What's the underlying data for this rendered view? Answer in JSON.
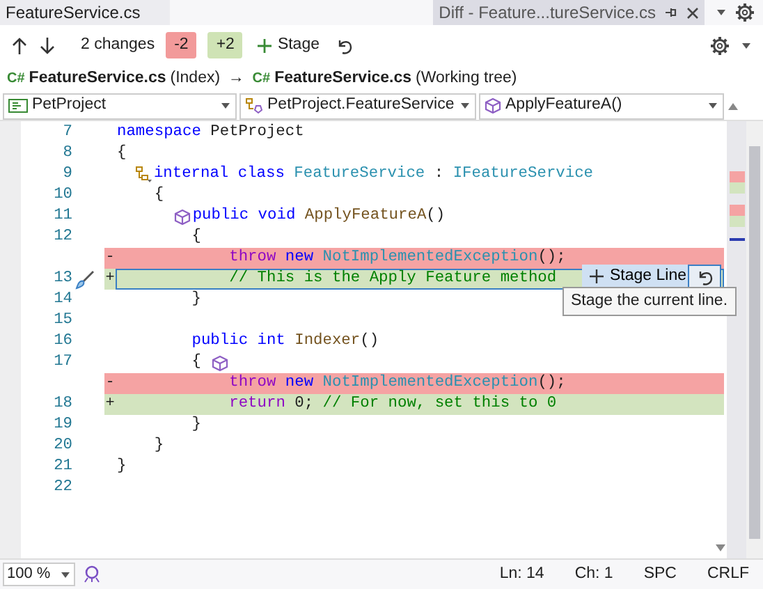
{
  "tabs": [
    {
      "label": "FeatureService.cs",
      "selected": false
    },
    {
      "label": "Diff - Feature...tureService.cs",
      "selected": true
    }
  ],
  "toolbar": {
    "changes": "2 changes",
    "removed": "-2",
    "added": "+2",
    "stage": "Stage"
  },
  "path": {
    "left_lang": "C#",
    "left_file": "FeatureService.cs",
    "left_label": "(Index)",
    "arrow": "→",
    "right_lang": "C#",
    "right_file": "FeatureService.cs",
    "right_label": "(Working tree)"
  },
  "dropdowns": [
    {
      "kind": "project",
      "label": "PetProject"
    },
    {
      "kind": "class",
      "label": "PetProject.FeatureService"
    },
    {
      "kind": "method",
      "label": "ApplyFeatureA()"
    }
  ],
  "lines": [
    {
      "number": "7",
      "kind": "context",
      "selected": false,
      "tokens": [
        {
          "kind": "keyword",
          "text": "namespace"
        },
        {
          "kind": "plain",
          "text": " PetProject"
        }
      ]
    },
    {
      "number": "8",
      "kind": "context",
      "selected": false,
      "tokens": [
        {
          "kind": "plain",
          "text": "{"
        }
      ]
    },
    {
      "number": "9",
      "kind": "context",
      "selected": false,
      "tokens": [
        {
          "kind": "indent"
        },
        {
          "kind": "class-icon"
        },
        {
          "kind": "keyword",
          "text": "internal class"
        },
        {
          "kind": "type",
          "text": " FeatureService"
        },
        {
          "kind": "plain",
          "text": " : "
        },
        {
          "kind": "type",
          "text": "IFeatureService"
        }
      ]
    },
    {
      "number": "10",
      "kind": "context",
      "selected": false,
      "tokens": [
        {
          "kind": "indent"
        },
        {
          "kind": "indent"
        },
        {
          "kind": "plain",
          "text": "{"
        }
      ]
    },
    {
      "number": "11",
      "kind": "context",
      "selected": false,
      "tokens": [
        {
          "kind": "indent"
        },
        {
          "kind": "indent"
        },
        {
          "kind": "indent"
        },
        {
          "kind": "method-icon"
        },
        {
          "kind": "keyword",
          "text": "public void"
        },
        {
          "kind": "method",
          "text": " ApplyFeatureA"
        },
        {
          "kind": "plain",
          "text": "()"
        }
      ]
    },
    {
      "number": "12",
      "kind": "context",
      "selected": false,
      "tokens": [
        {
          "kind": "indent"
        },
        {
          "kind": "indent"
        },
        {
          "kind": "indent"
        },
        {
          "kind": "indent"
        },
        {
          "kind": "plain",
          "text": "{"
        }
      ]
    },
    {
      "kind": "deleted",
      "marker": "-",
      "selected": false,
      "tokens": [
        {
          "kind": "indent"
        },
        {
          "kind": "indent"
        },
        {
          "kind": "indent"
        },
        {
          "kind": "indent"
        },
        {
          "kind": "indent"
        },
        {
          "kind": "indent"
        },
        {
          "kind": "control",
          "text": "throw"
        },
        {
          "kind": "keyword",
          "text": " new"
        },
        {
          "kind": "type",
          "text": " NotImplementedException"
        },
        {
          "kind": "plain",
          "text": "();"
        }
      ]
    },
    {
      "number": "13",
      "kind": "added",
      "marker": "+",
      "selected": true,
      "tokens": [
        {
          "kind": "indent"
        },
        {
          "kind": "indent"
        },
        {
          "kind": "indent"
        },
        {
          "kind": "indent"
        },
        {
          "kind": "indent"
        },
        {
          "kind": "indent"
        },
        {
          "kind": "comment",
          "text": "// This is the Apply Feature method"
        }
      ]
    },
    {
      "number": "14",
      "kind": "context",
      "selected": false,
      "tokens": [
        {
          "kind": "indent"
        },
        {
          "kind": "indent"
        },
        {
          "kind": "indent"
        },
        {
          "kind": "indent"
        },
        {
          "kind": "plain",
          "text": "}"
        }
      ]
    },
    {
      "number": "15",
      "kind": "context",
      "selected": false
    },
    {
      "number": "16",
      "kind": "context",
      "selected": false,
      "tokens": [
        {
          "kind": "indent"
        },
        {
          "kind": "indent"
        },
        {
          "kind": "indent"
        },
        {
          "kind": "indent"
        },
        {
          "kind": "keyword",
          "text": "public int"
        },
        {
          "kind": "method",
          "text": " Indexer"
        },
        {
          "kind": "plain",
          "text": "()"
        }
      ]
    },
    {
      "number": "17",
      "kind": "context",
      "selected": false,
      "tokens": [
        {
          "kind": "indent"
        },
        {
          "kind": "indent"
        },
        {
          "kind": "indent"
        },
        {
          "kind": "indent"
        },
        {
          "kind": "plain",
          "text": "{ "
        },
        {
          "kind": "method-icon"
        }
      ]
    },
    {
      "kind": "deleted",
      "marker": "-",
      "selected": false,
      "tokens": [
        {
          "kind": "indent"
        },
        {
          "kind": "indent"
        },
        {
          "kind": "indent"
        },
        {
          "kind": "indent"
        },
        {
          "kind": "indent"
        },
        {
          "kind": "indent"
        },
        {
          "kind": "control",
          "text": "throw"
        },
        {
          "kind": "keyword",
          "text": " new"
        },
        {
          "kind": "type",
          "text": " NotImplementedException"
        },
        {
          "kind": "plain",
          "text": "();"
        }
      ]
    },
    {
      "number": "18",
      "kind": "added",
      "marker": "+",
      "selected": false,
      "tokens": [
        {
          "kind": "indent"
        },
        {
          "kind": "indent"
        },
        {
          "kind": "indent"
        },
        {
          "kind": "indent"
        },
        {
          "kind": "indent"
        },
        {
          "kind": "indent"
        },
        {
          "kind": "control",
          "text": "return"
        },
        {
          "kind": "plain",
          "text": " 0; "
        },
        {
          "kind": "comment",
          "text": "// For now, set this to 0"
        }
      ]
    },
    {
      "number": "19",
      "kind": "context",
      "selected": false,
      "tokens": [
        {
          "kind": "indent"
        },
        {
          "kind": "indent"
        },
        {
          "kind": "indent"
        },
        {
          "kind": "indent"
        },
        {
          "kind": "plain",
          "text": "}"
        }
      ]
    },
    {
      "number": "20",
      "kind": "context",
      "selected": false,
      "tokens": [
        {
          "kind": "indent"
        },
        {
          "kind": "indent"
        },
        {
          "kind": "plain",
          "text": "}"
        }
      ]
    },
    {
      "number": "21",
      "kind": "context",
      "selected": false,
      "tokens": [
        {
          "kind": "plain",
          "text": "}"
        }
      ]
    },
    {
      "number": "22",
      "kind": "context",
      "selected": false
    }
  ],
  "inline_actions": {
    "stage_line": "Stage Line",
    "tooltip": "Stage the current line."
  },
  "status_bar": {
    "zoom": "100 %",
    "line": "Ln: 14",
    "column": "Ch: 1",
    "indent": "SPC",
    "line_ending": "CRLF"
  }
}
